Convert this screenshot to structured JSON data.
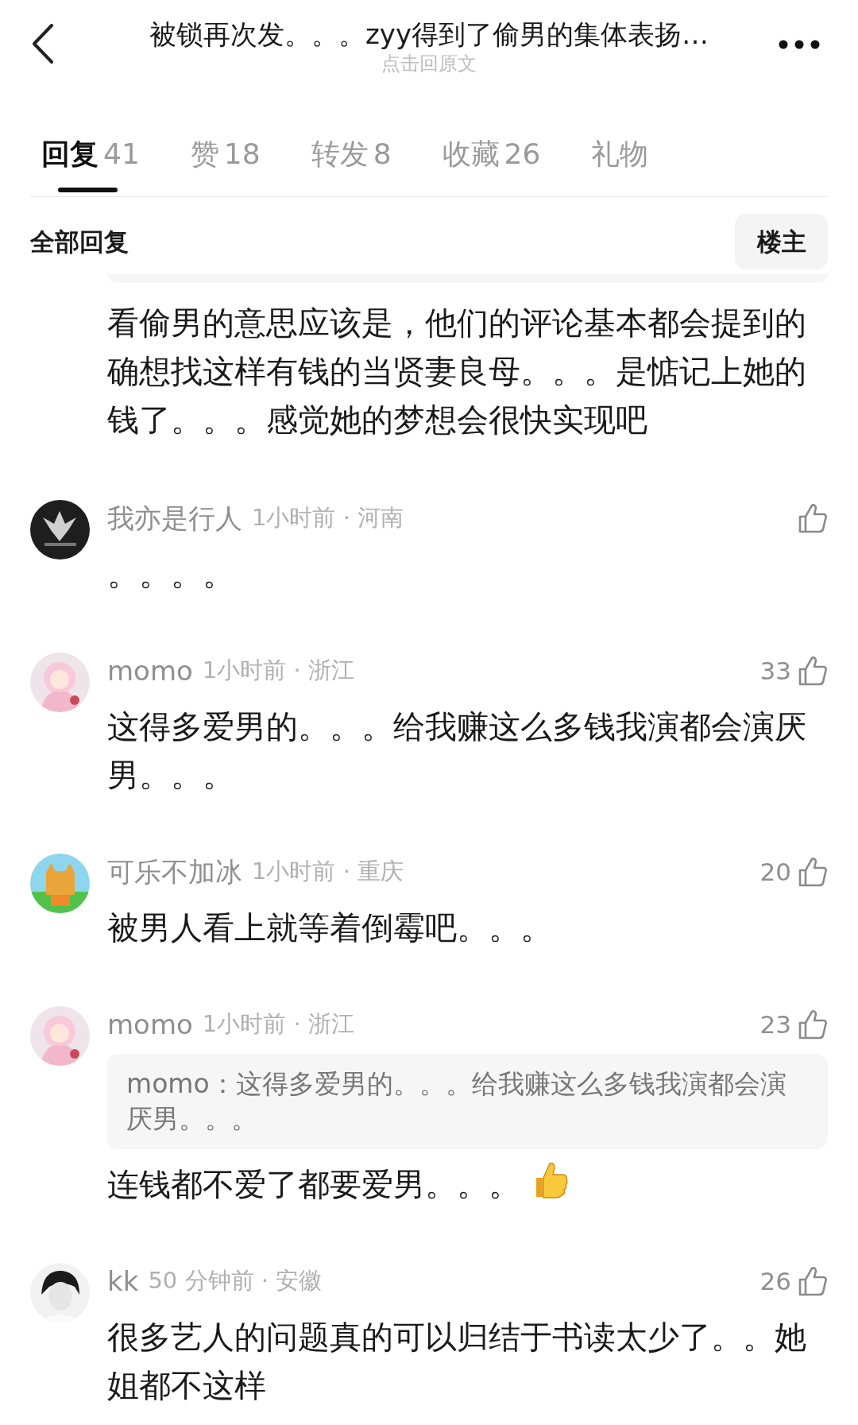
{
  "header": {
    "title": "被锁再次发。。。zyy得到了偷男的集体表扬…",
    "subtitle": "点击回原文"
  },
  "tabs": [
    {
      "label": "回复",
      "count": "41",
      "selected": true
    },
    {
      "label": "赞",
      "count": "18",
      "selected": false
    },
    {
      "label": "转发",
      "count": "8",
      "selected": false
    },
    {
      "label": "收藏",
      "count": "26",
      "selected": false
    },
    {
      "label": "礼物",
      "selected": false
    }
  ],
  "section": {
    "title": "全部回复",
    "filter_button": "楼主"
  },
  "partial_comment": {
    "text": "看偷男的意思应该是，他们的评论基本都会提到的确想找这样有钱的当贤妻良母。。。是惦记上她的钱了。。。感觉她的梦想会很快实现吧"
  },
  "comments": [
    {
      "name": "我亦是行人",
      "meta": "1小时前 · 河南",
      "text": "。。。。"
    },
    {
      "name": "momo",
      "meta": "1小时前 · 浙江",
      "likes": "33",
      "text": "这得多爱男的。。。给我赚这么多钱我演都会演厌男。。。"
    },
    {
      "name": "可乐不加冰",
      "meta": "1小时前 · 重庆",
      "likes": "20",
      "text": "被男人看上就等着倒霉吧。。。"
    },
    {
      "name": "momo",
      "meta": "1小时前 · 浙江",
      "likes": "23",
      "quote": "momo：这得多爱男的。。。给我赚这么多钱我演都会演厌男。。。",
      "text": "连钱都不爱了都要爱男。。。",
      "thumb_emoji": true
    },
    {
      "name": "kk",
      "meta": "50 分钟前 · 安徽",
      "likes": "26",
      "text": "很多艺人的问题真的可以归结于书读太少了。。她姐都不这样"
    }
  ]
}
